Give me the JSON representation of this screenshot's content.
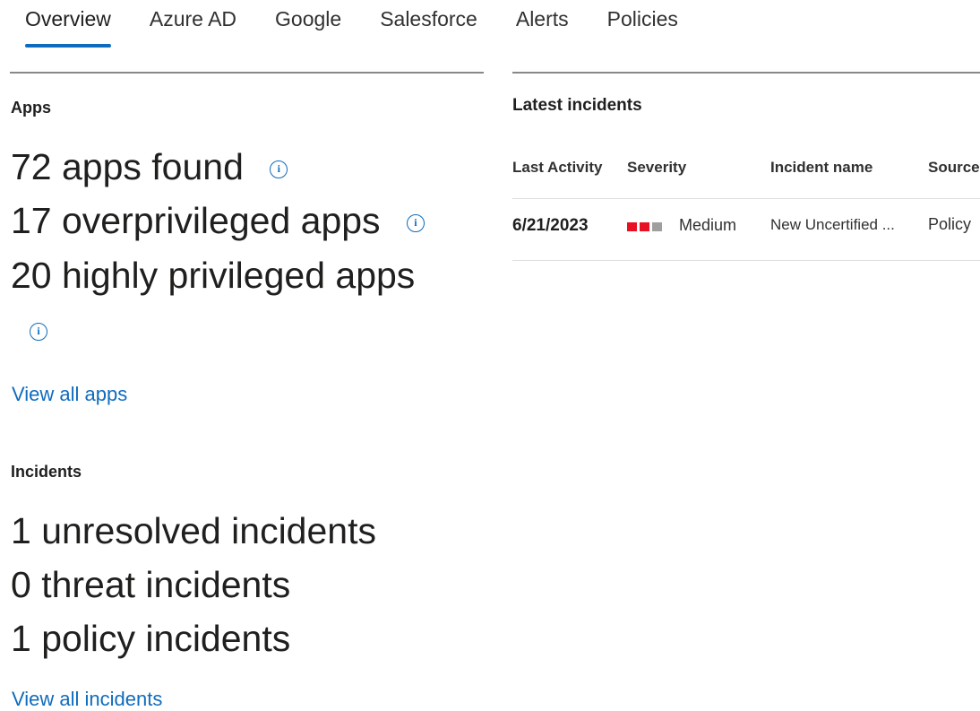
{
  "tabs": [
    {
      "label": "Overview",
      "active": true
    },
    {
      "label": "Azure AD",
      "active": false
    },
    {
      "label": "Google",
      "active": false
    },
    {
      "label": "Salesforce",
      "active": false
    },
    {
      "label": "Alerts",
      "active": false
    },
    {
      "label": "Policies",
      "active": false
    }
  ],
  "apps": {
    "title": "Apps",
    "apps_found": "72 apps found",
    "overprivileged": "17 overprivileged apps",
    "highly_privileged": "20 highly privileged apps",
    "view_all_link": "View all apps",
    "info_icon": "info-icon"
  },
  "incidents": {
    "title": "Incidents",
    "unresolved": "1 unresolved incidents",
    "threat": "0 threat incidents",
    "policy": "1 policy incidents",
    "view_all_link": "View all incidents"
  },
  "latest_incidents": {
    "title": "Latest incidents",
    "columns": [
      "Last Activity",
      "Severity",
      "Incident name",
      "Source"
    ],
    "rows": [
      {
        "last_activity": "6/21/2023",
        "severity": "Medium",
        "severity_level": 2,
        "severity_max": 3,
        "incident_name": "New Uncertified ...",
        "source": "Policy"
      }
    ]
  },
  "colors": {
    "accent": "#0f6cbd",
    "severity_active": "#e81123",
    "severity_inactive": "#a19f9d"
  }
}
